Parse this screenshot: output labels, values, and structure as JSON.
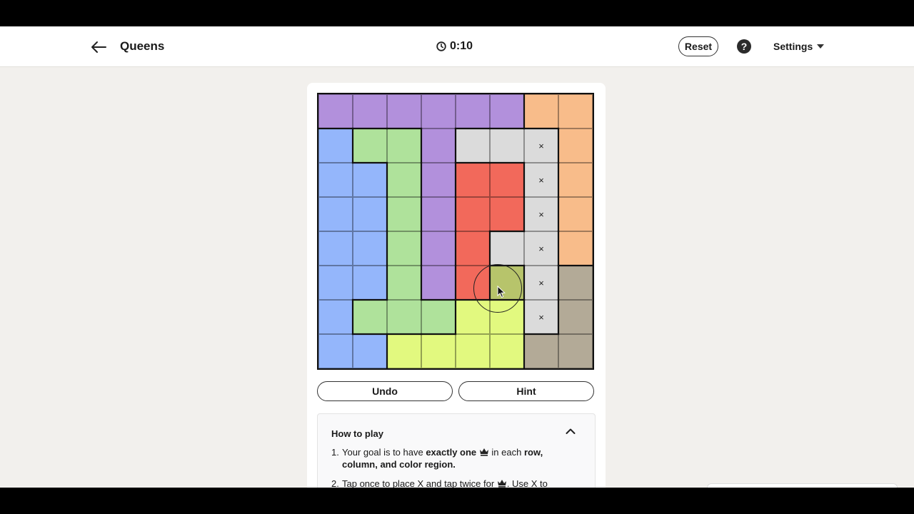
{
  "header": {
    "title": "Queens",
    "timer": "0:10",
    "reset_label": "Reset",
    "help_label": "?",
    "settings_label": "Settings"
  },
  "board": {
    "size": 8,
    "regions": [
      [
        "purple",
        "purple",
        "purple",
        "purple",
        "purple",
        "purple",
        "orange",
        "orange"
      ],
      [
        "blue",
        "green",
        "green",
        "purple",
        "gray",
        "gray",
        "gray",
        "orange"
      ],
      [
        "blue",
        "blue",
        "green",
        "purple",
        "red",
        "red",
        "gray",
        "orange"
      ],
      [
        "blue",
        "blue",
        "green",
        "purple",
        "red",
        "red",
        "gray",
        "orange"
      ],
      [
        "blue",
        "blue",
        "green",
        "purple",
        "red",
        "gray",
        "gray",
        "orange"
      ],
      [
        "blue",
        "blue",
        "green",
        "purple",
        "red",
        "olive",
        "gray",
        "taupe"
      ],
      [
        "blue",
        "green",
        "green",
        "green",
        "yellow",
        "yellow",
        "gray",
        "taupe"
      ],
      [
        "blue",
        "blue",
        "yellow",
        "yellow",
        "yellow",
        "yellow",
        "taupe",
        "taupe"
      ]
    ],
    "marks": [
      [
        "",
        "",
        "",
        "",
        "",
        "",
        "",
        ""
      ],
      [
        "",
        "",
        "",
        "",
        "",
        "",
        "×",
        ""
      ],
      [
        "",
        "",
        "",
        "",
        "",
        "",
        "×",
        ""
      ],
      [
        "",
        "",
        "",
        "",
        "",
        "",
        "×",
        ""
      ],
      [
        "",
        "",
        "",
        "",
        "",
        "",
        "×",
        ""
      ],
      [
        "",
        "",
        "",
        "",
        "",
        "",
        "×",
        ""
      ],
      [
        "",
        "",
        "",
        "",
        "",
        "",
        "×",
        ""
      ],
      [
        "",
        "",
        "",
        "",
        "",
        "",
        "",
        ""
      ]
    ],
    "colors": {
      "purple": "#b290dc",
      "orange": "#f8bc8a",
      "blue": "#94b6fb",
      "green": "#afe29b",
      "gray": "#dbdbdb",
      "red": "#f2695b",
      "yellow": "#e2f97f",
      "taupe": "#b3aa97",
      "olive": "#b7c46b"
    }
  },
  "actions": {
    "undo_label": "Undo",
    "hint_label": "Hint"
  },
  "howto": {
    "title": "How to play",
    "rule1": {
      "num": "1.",
      "a": "Your goal is to have ",
      "b": "exactly one",
      "c": " in each ",
      "d": "row, column, and color region."
    },
    "rule2": {
      "num": "2.",
      "a": "Tap once to place X and tap twice for",
      "b": ". Use X to"
    }
  }
}
